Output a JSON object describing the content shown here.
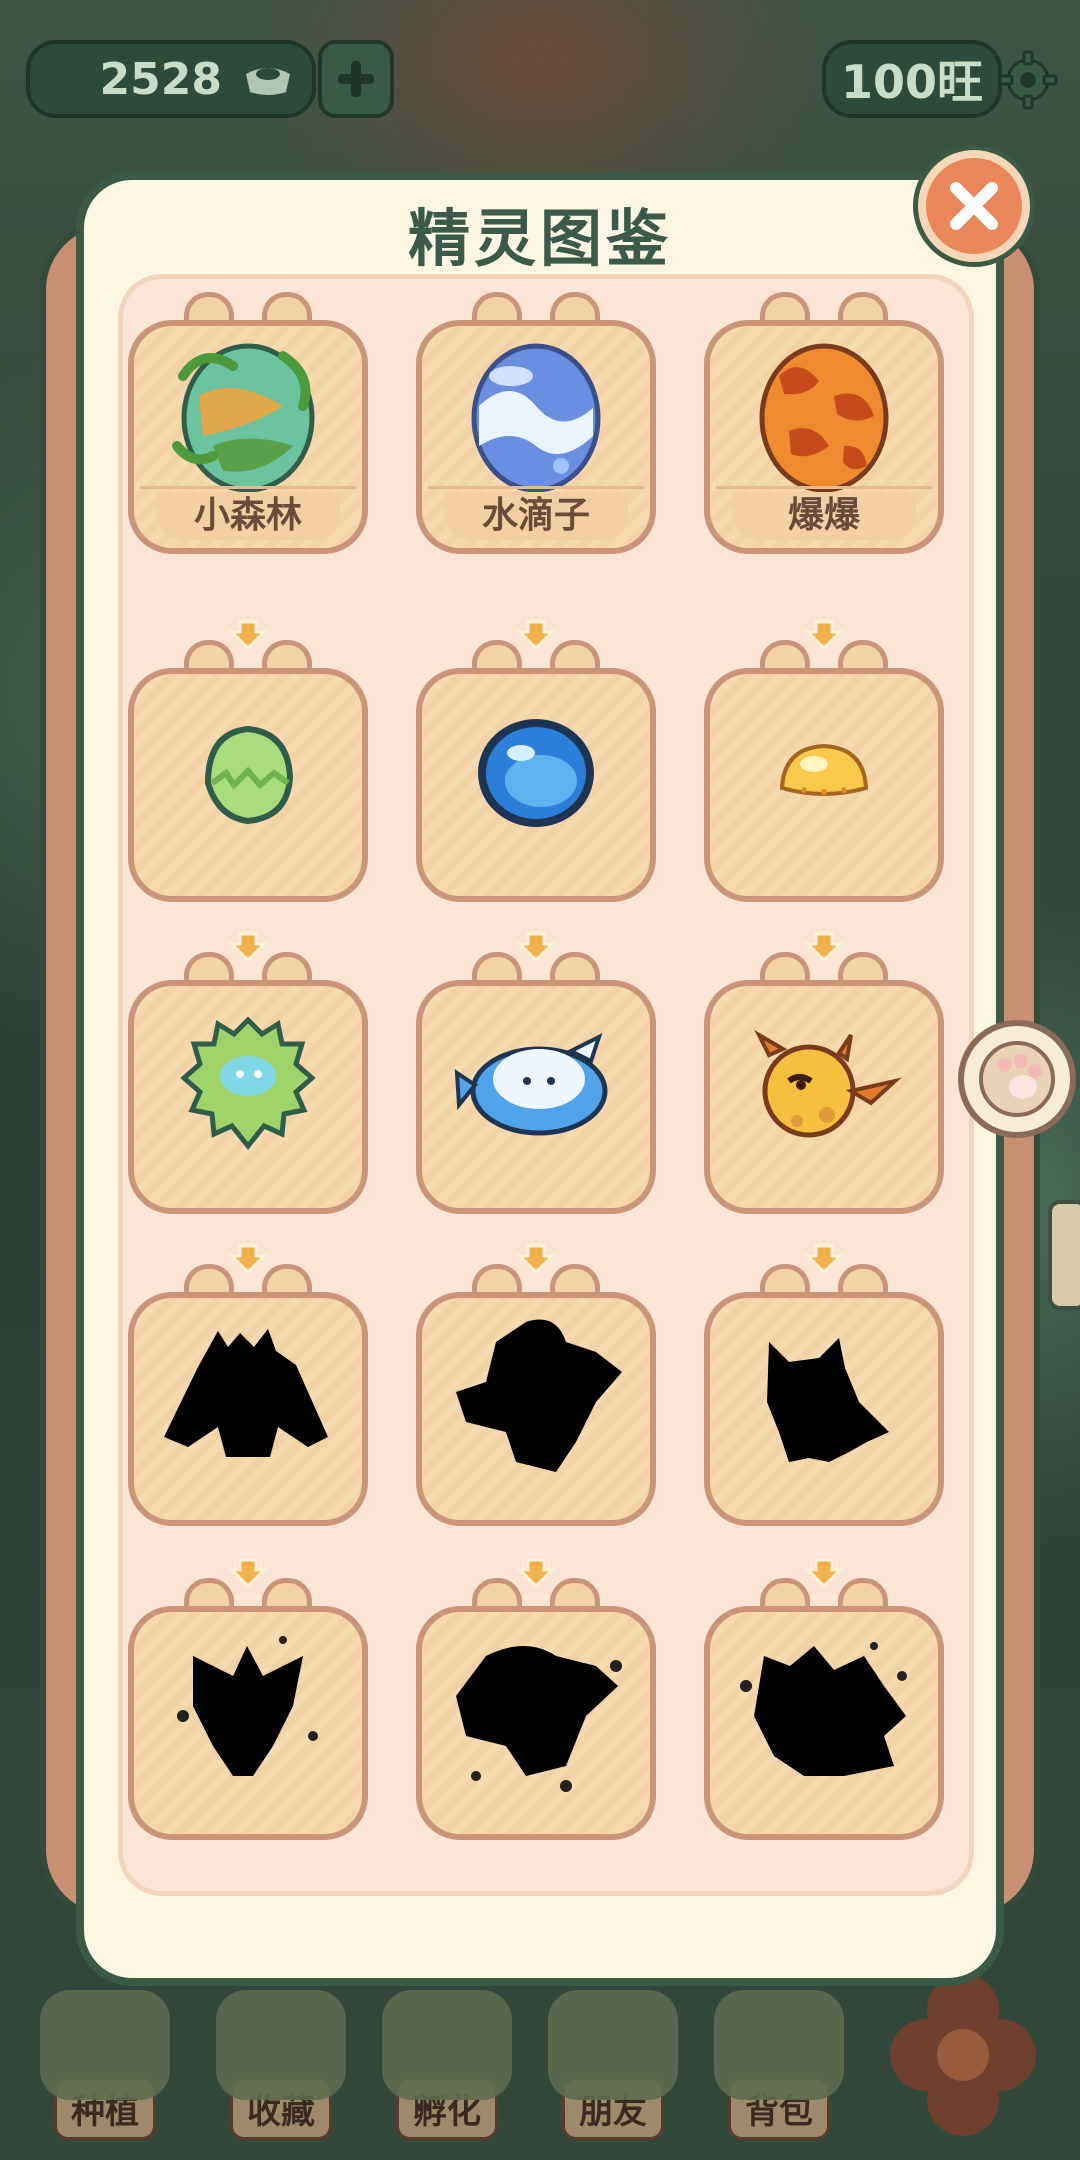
{
  "hud": {
    "coins": "2528",
    "currency": "100旺"
  },
  "dialog": {
    "title": "精灵图鉴"
  },
  "eggs": [
    {
      "name": "小森林"
    },
    {
      "name": "水滴子"
    },
    {
      "name": "爆爆"
    }
  ],
  "bottom_nav": [
    {
      "label": "种植"
    },
    {
      "label": "收藏"
    },
    {
      "label": "孵化"
    },
    {
      "label": "朋友"
    },
    {
      "label": "背包"
    }
  ]
}
